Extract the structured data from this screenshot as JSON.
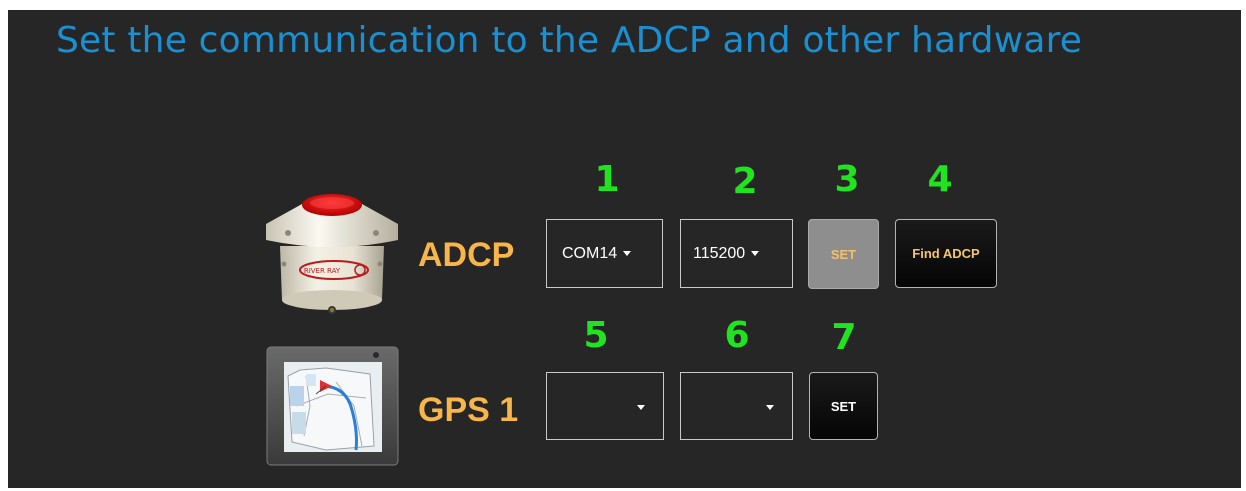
{
  "title": "Set the communication to the ADCP and other hardware",
  "step_numbers": [
    "1",
    "2",
    "3",
    "4",
    "5",
    "6",
    "7"
  ],
  "adcp": {
    "label": "ADCP",
    "port": "COM14",
    "baud": "115200",
    "set_label": "SET",
    "find_label": "Find ADCP",
    "icon": "adcp-device-icon",
    "device_text": "RIVER RAY"
  },
  "gps": {
    "label": "GPS 1",
    "port": "",
    "baud": "",
    "set_label": "SET",
    "icon": "gps-tablet-icon"
  },
  "colors": {
    "title": "#1a8fd1",
    "numbers": "#21e421",
    "labels": "#f7b54a",
    "background": "#262626"
  }
}
